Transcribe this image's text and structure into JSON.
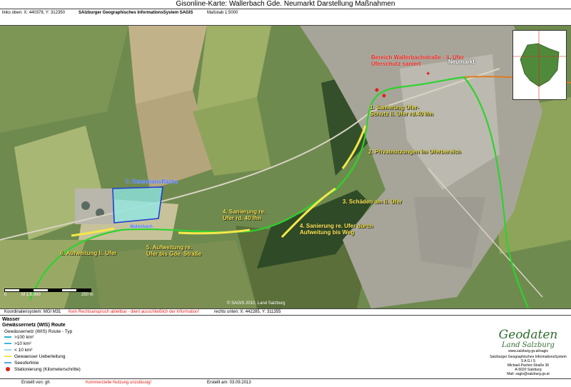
{
  "title": "Gisonline-Karte: Wallerbach Gde. Neumarkt Darstellung Maßnahmen",
  "header": {
    "coords_top_left": "links oben: X: 440378, Y: 312350",
    "system_name": "SAlzburger Geographisches InformationsSystem SAGIS",
    "scale": "Maßstab 1:5000"
  },
  "map": {
    "labels": {
      "m1": "1. Sanierung Ufer-\nSchutz li. Ufer rd.40 lfm",
      "m2": "2. Privatnutzungen im Uferbereich",
      "m3": "3. Schäden am li. Ufer",
      "m4a": "4. Sanierung re. Ufer durch\nAufweitung bis Weg",
      "m4b": "4. Sanierung re.\nUfer rd. 40 lfm",
      "m5": "5. Aufweitung re.\nUfer bis Gde. Straße",
      "m6": "6. Aufweitung li. Ufer",
      "m7": "7. Retentionsfläche",
      "walle": "Bereich Wallerbachstraße - li. Ufer\nUferschutz saniert",
      "place": "Neumarkt",
      "stream": "Wallerbach"
    },
    "scalebar": {
      "start": "0",
      "ratio": "M 1:5.000",
      "end": "250 m"
    },
    "copyright": "© SAGIS 2010, Land Salzburg"
  },
  "footer": {
    "coordsys": "Koordinatensystem: MGI M31",
    "disclaimer": "Kein Rechtsanspruch ableitbar - dient ausschließlich der Information!",
    "coords_bottom_right": "rechts unten: X: 442285, Y: 311355"
  },
  "legend": {
    "group": "Wasser",
    "layer": "Gewässernetz (WIS) Route",
    "subtitle": "Gewässernetz (WIS) Route - Typ",
    "items": [
      {
        "label": ">100 km²",
        "color": "#29b3c9"
      },
      {
        "label": ">10 km²",
        "color": "#3fb6e6"
      },
      {
        "label": "< 10 km²",
        "color": "#9ed6f0"
      },
      {
        "label": "Gewaesser Ueberleitung",
        "color": "#f3e84a"
      },
      {
        "label": "Seeuferlinie",
        "color": "#56a8e0"
      },
      {
        "label": "Stationierung (Kilometerschritte)",
        "color": "#e0201a"
      }
    ]
  },
  "logo": {
    "line1": "Geodaten",
    "line2": "Land Salzburg",
    "url": "www.salzburg.gv.at/sagis",
    "org": "Salzburger Geographisches InformationsSystem",
    "abbr": "S A G I S",
    "street": "Michael-Pacher-Straße 36",
    "city": "A-5020 Salzburg",
    "mail": "Mail: sagis@salzburg.gv.at"
  },
  "bottom": {
    "created_by": "Erstellt von: gh",
    "usage": "Kommerzielle Nutzung unzulässig!",
    "created_on": "Erstellt am: 03.09.2013"
  },
  "colors": {
    "stream_green": "#2fd12f",
    "measure_yellow": "#f3e84a",
    "retention_blue": "#3b6cff",
    "station_red": "#e0201a",
    "stream_orange": "#e07a20"
  }
}
